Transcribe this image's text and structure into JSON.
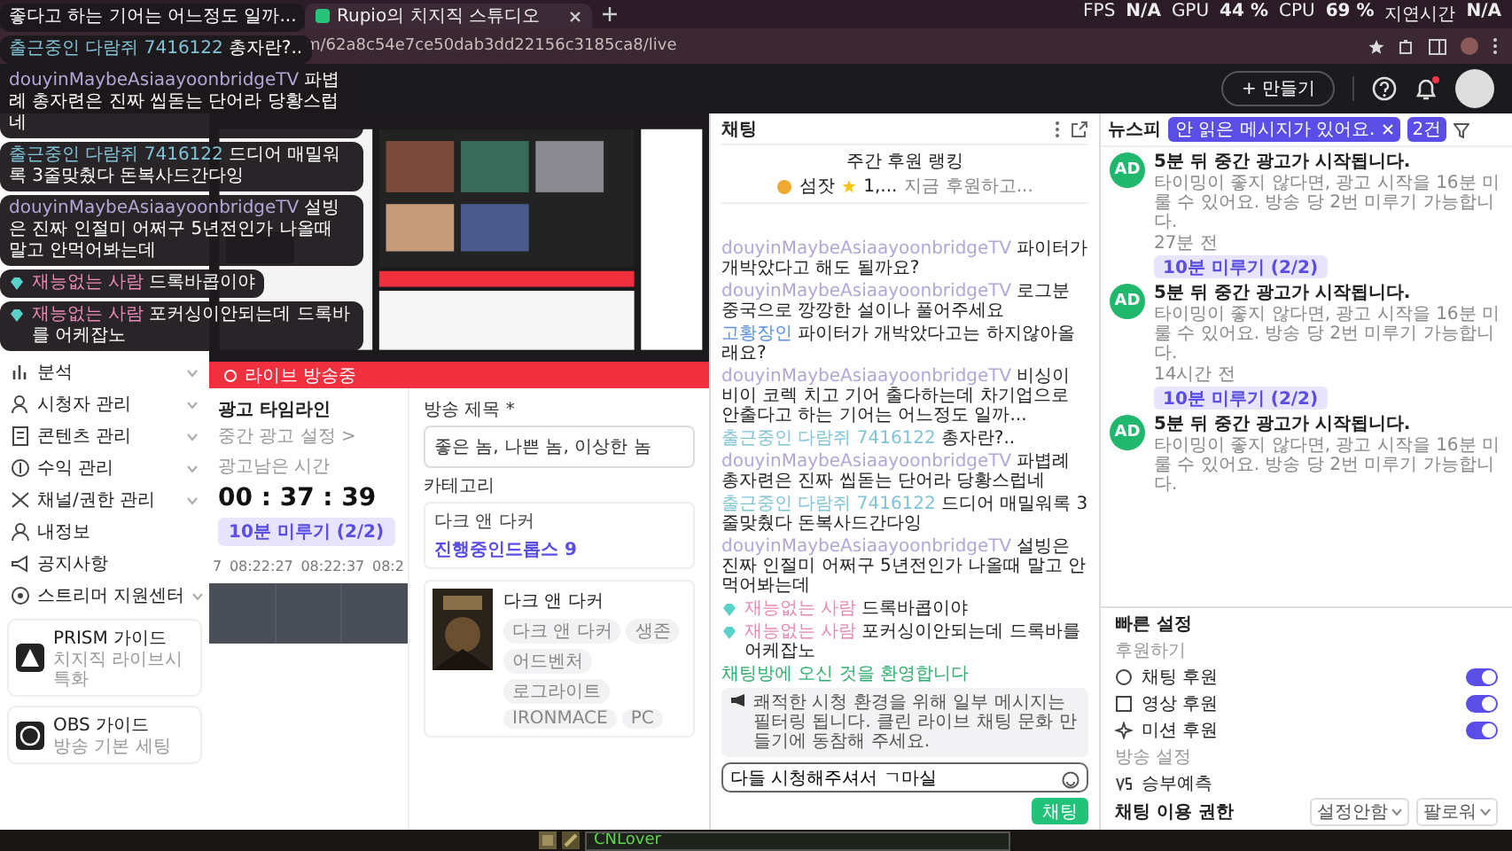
{
  "browser": {
    "tabs": [
      {
        "title": "Rupio의 치지직 스튜디오",
        "selected": true
      }
    ],
    "url": "m/62a8c54e7ce50dab3dd22156c3185ca8/live"
  },
  "perf_overlay": [
    {
      "label": "FPS",
      "value": "N/A"
    },
    {
      "label": "GPU",
      "value": "44 %"
    },
    {
      "label": "CPU",
      "value": "69 %"
    },
    {
      "label": "지연시간",
      "value": "N/A"
    }
  ],
  "chat_overlay": [
    {
      "text": "좋다고 하는 기어는 어느정도 일까...",
      "diamond": false
    },
    {
      "nick": "출근중인 다람쥐 7416122",
      "text": "총자란?..",
      "color": "#7fc4d6",
      "diamond": false
    },
    {
      "nick": "douyinMaybeAsiaayoonbridgeTV",
      "text": "파볍례 총자련은 진짜 씹돋는 단어라 당황스럽네",
      "color": "#b3a6d6",
      "diamond": false
    },
    {
      "nick": "출근중인 다람쥐 7416122",
      "text": "드디어 매밀워록 3줄맞췄다 돈복사드간다잉",
      "color": "#7fc4d6",
      "diamond": false
    },
    {
      "nick": "douyinMaybeAsiaayoonbridgeTV",
      "text": "설빙은 진짜 인절미 어쩌구 5년전인가 나올때 말고 안먹어봐는데",
      "color": "#b3a6d6",
      "diamond": false
    },
    {
      "nick": "재능없는 사람",
      "text": "드록바콥이야",
      "color": "#e889b6",
      "diamond": true
    },
    {
      "nick": "재능없는 사람",
      "text": "포커싱이안되는데 드록바를 어케잡노",
      "color": "#e889b6",
      "diamond": true
    }
  ],
  "header": {
    "create_button": "+ 만들기",
    "unread": true
  },
  "sidebar": {
    "items": [
      {
        "label": "분석",
        "expanded": false
      },
      {
        "label": "시청자 관리",
        "expanded": false
      },
      {
        "label": "콘텐츠 관리",
        "expanded": false
      },
      {
        "label": "수익 관리",
        "expanded": false
      },
      {
        "label": "채널/권한 관리",
        "expanded": false
      },
      {
        "label": "내정보"
      },
      {
        "label": "공지사항"
      },
      {
        "label": "스트리머 지원센터",
        "expanded": false
      }
    ],
    "guides": [
      {
        "title": "PRISM 가이드",
        "subtitle": "치지직 라이브시 특화"
      },
      {
        "title": "OBS 가이드",
        "subtitle": "방송 기본 세팅"
      }
    ]
  },
  "live_bar": "라이브 방송중",
  "ad_timeline": {
    "title": "광고 타임라인",
    "settings_link": "중간 광고 설정 >",
    "remaining_label": "광고남은 시간",
    "remaining": "00 : 37 : 39",
    "delay_button": "10분 미루기 (2/2)",
    "ticks": [
      "7",
      "08:22:27",
      "08:22:37",
      "08:2"
    ]
  },
  "broadcast": {
    "title_label": "방송 제목 *",
    "title_value": "좋은 놈, 나쁜 놈, 이상한 놈",
    "category_label": "카테고리",
    "category_value": "다크 앤 다커",
    "drops": "진행중인드롭스 9",
    "game": {
      "name": "다크 앤 다커",
      "tags": [
        "다크 앤 다커",
        "생존",
        "어드벤처",
        "로그라이트",
        "IRONMACE",
        "PC"
      ]
    }
  },
  "chat": {
    "title": "채팅",
    "ranking": {
      "title": "주간 후원 랭킹",
      "top": "섬잣",
      "amount": "1,...",
      "prompt": "지금 후원하고..."
    },
    "messages": [
      {
        "nick": "douyinMaybeAsiaayoonbridgeTV",
        "text": "파이터가 개박았다고 해도 될까요?",
        "color": "#b3a6d6",
        "diamond": false
      },
      {
        "nick": "douyinMaybeAsiaayoonbridgeTV",
        "text": "로그분 중국으로 깡깡한 설이나 풀어주세요",
        "color": "#b3a6d6",
        "diamond": false
      },
      {
        "nick": "고황장인",
        "text": "파이터가 개박았다고는 하지않아올래요?",
        "color": "#5b8fe0",
        "diamond": false
      },
      {
        "nick": "douyinMaybeAsiaayoonbridgeTV",
        "text": "비싱이 비이 코렉 치고 기어 출다하는데 차기업으로 안출다고 하는 기어는 어느정도 일까...",
        "color": "#b3a6d6",
        "diamond": false
      },
      {
        "nick": "출근중인 다람쥐 7416122",
        "text": "총자란?..",
        "color": "#7fc4d6",
        "diamond": false
      },
      {
        "nick": "douyinMaybeAsiaayoonbridgeTV",
        "text": "파볍례 총자련은 진짜 씹돋는 단어라 당황스럽네",
        "color": "#b3a6d6",
        "diamond": false
      },
      {
        "nick": "출근중인 다람쥐 7416122",
        "text": "드디어 매밀워록 3줄맞췄다 돈복사드간다잉",
        "color": "#7fc4d6",
        "diamond": false
      },
      {
        "nick": "douyinMaybeAsiaayoonbridgeTV",
        "text": "설빙은 진짜 인절미 어쩌구 5년전인가 나올때 말고 안먹어봐는데",
        "color": "#b3a6d6",
        "diamond": false
      },
      {
        "nick": "재능없는 사람",
        "text": "드록바콥이야",
        "color": "#e889b6",
        "diamond": true
      },
      {
        "nick": "재능없는 사람",
        "text": "포커싱이안되는데 드록바를 어케잡노",
        "color": "#e889b6",
        "diamond": true
      }
    ],
    "welcome": "채팅방에 오신 것을 환영합니다",
    "notice": "쾌적한 시청 환경을 위해 일부 메시지는 필터링 됩니다. 클린 라이브 채팅 문화 만들기에 동참해 주세요.",
    "input_value": "다들 시청해주셔서 ㄱ마실",
    "send_button": "채팅"
  },
  "feed": {
    "title": "뉴스피",
    "tooltip": "안 읽은 메시지가 있어요.",
    "count_button": "2건",
    "items": [
      {
        "avatar": "AD",
        "title": "5분 뒤 중간 광고가 시작됩니다.",
        "body": "타이밍이 좋지 않다면, 광고 시작을 16분 미룰 수 있어요. 방송 당 2번 미루기 가능합니다.",
        "time": "27분 전",
        "button": "10분 미루기 (2/2)"
      },
      {
        "avatar": "AD",
        "title": "5분 뒤 중간 광고가 시작됩니다.",
        "body": "타이밍이 좋지 않다면, 광고 시작을 16분 미룰 수 있어요. 방송 당 2번 미루기 가능합니다.",
        "time": "14시간 전",
        "button": "10분 미루기 (2/2)"
      },
      {
        "avatar": "AD",
        "title": "5분 뒤 중간 광고가 시작됩니다.",
        "body": "타이밍이 좋지 않다면, 광고 시작을 16분 미룰 수 있어요. 방송 당 2번 미루기 가능합니다."
      }
    ]
  },
  "quick_settings": {
    "title": "빠른 설정",
    "donation_label": "후원하기",
    "toggles": [
      {
        "label": "채팅 후원",
        "on": true
      },
      {
        "label": "영상 후원",
        "on": true
      },
      {
        "label": "미션 후원",
        "on": true
      }
    ],
    "broadcast_label": "방송 설정",
    "prediction": "승부예측",
    "permission_label": "채팅 이용 권한",
    "dropdowns": [
      "설정안함",
      "팔로워"
    ]
  },
  "game_bar": {
    "input_value": "CNLover"
  }
}
